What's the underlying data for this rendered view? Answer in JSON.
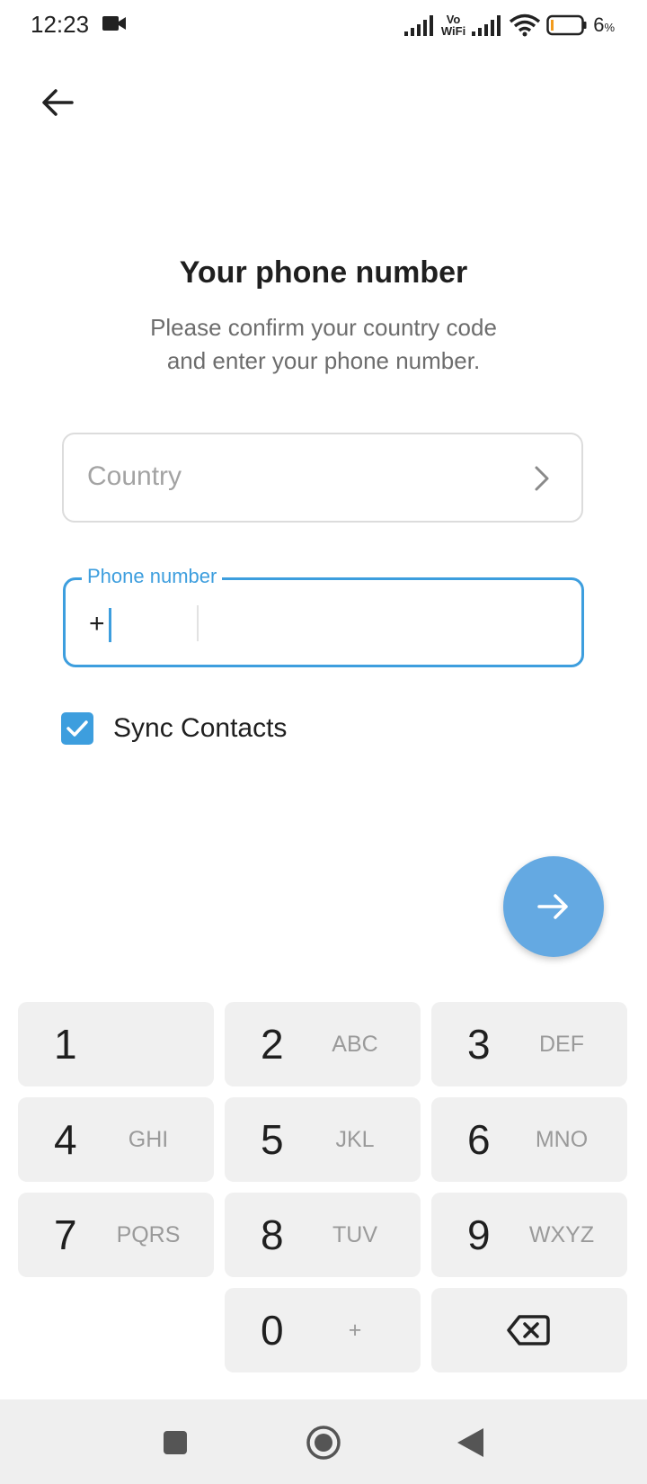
{
  "status_bar": {
    "time": "12:23",
    "vowifi_top": "Vo",
    "vowifi_bottom": "WiFi",
    "battery_percent": "6",
    "battery_unit": "%",
    "icons": [
      "video-icon",
      "signal-icon",
      "vowifi-icon",
      "signal-icon",
      "wifi-icon",
      "battery-icon"
    ]
  },
  "header": {
    "back_icon": "arrow-left-icon"
  },
  "title": "Your phone number",
  "subtitle_line1": "Please confirm your country code",
  "subtitle_line2": "and enter your phone number.",
  "country": {
    "placeholder": "Country",
    "icon": "chevron-right-icon"
  },
  "phone": {
    "label": "Phone number",
    "prefix": "+",
    "value": ""
  },
  "sync_contacts": {
    "label": "Sync Contacts",
    "checked": true
  },
  "next_button": {
    "icon": "arrow-right-icon",
    "color": "#64a9e2"
  },
  "keypad": {
    "keys": [
      {
        "digit": "1",
        "letters": ""
      },
      {
        "digit": "2",
        "letters": "ABC"
      },
      {
        "digit": "3",
        "letters": "DEF"
      },
      {
        "digit": "4",
        "letters": "GHI"
      },
      {
        "digit": "5",
        "letters": "JKL"
      },
      {
        "digit": "6",
        "letters": "MNO"
      },
      {
        "digit": "7",
        "letters": "PQRS"
      },
      {
        "digit": "8",
        "letters": "TUV"
      },
      {
        "digit": "9",
        "letters": "WXYZ"
      },
      {
        "digit": "0",
        "letters": "+"
      }
    ],
    "backspace_icon": "backspace-icon"
  },
  "nav_bar": {
    "icons": [
      "recents-square-icon",
      "home-circle-icon",
      "back-triangle-icon"
    ]
  },
  "colors": {
    "accent": "#3d9ede",
    "fab": "#64a9e2",
    "key_bg": "#f0f0f0",
    "nav_bg": "#efefef"
  }
}
